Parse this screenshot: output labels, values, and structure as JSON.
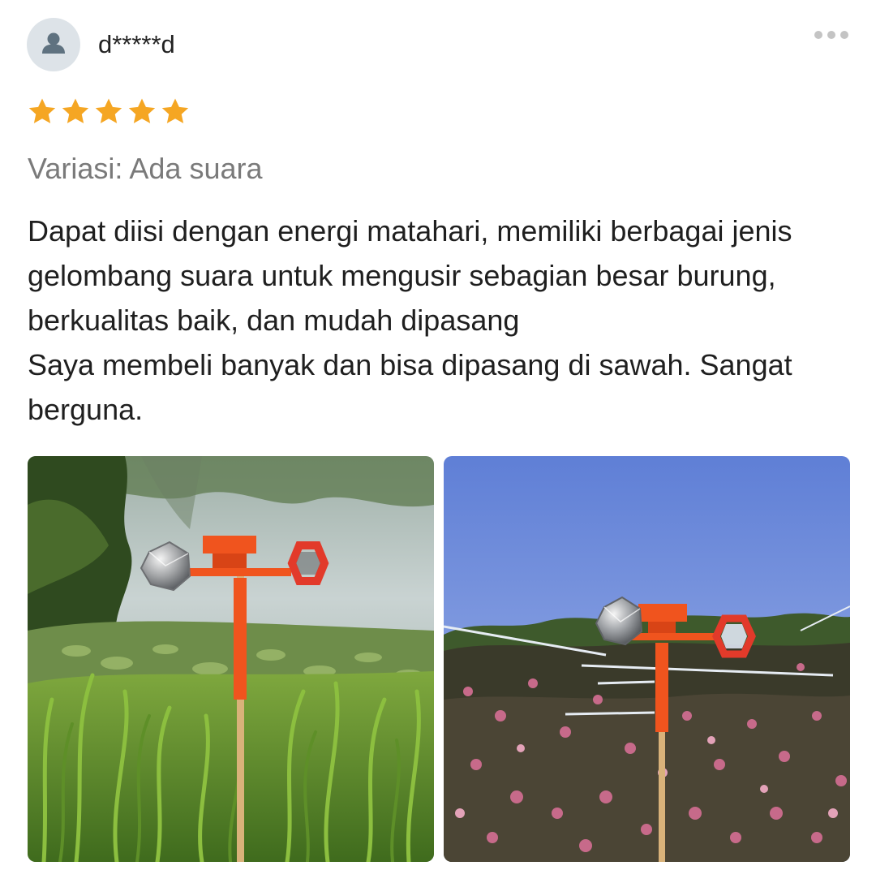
{
  "review": {
    "username": "d*****d",
    "avatar_icon": "user-icon",
    "more_icon": "more-dots-icon",
    "rating": 5,
    "rating_max": 5,
    "star_color": "#f5a623",
    "variation": "Variasi: Ada suara",
    "text_paragraphs": [
      "Dapat diisi dengan energi matahari, memiliki berbagai jenis gelombang suara untuk mengusir sebagian besar burung, berkualitas baik, dan mudah dipasang",
      "Saya membeli banyak dan bisa dipasang di sawah. Sangat berguna."
    ]
  },
  "photos": [
    {
      "scene": "bird-repeller-by-pond"
    },
    {
      "scene": "bird-repeller-in-apple-orchard"
    }
  ],
  "colors": {
    "device_orange": "#f0541e",
    "avatar_bg": "#dde3e8",
    "avatar_icon": "#5f7280",
    "muted_text": "#7a7a7a"
  }
}
